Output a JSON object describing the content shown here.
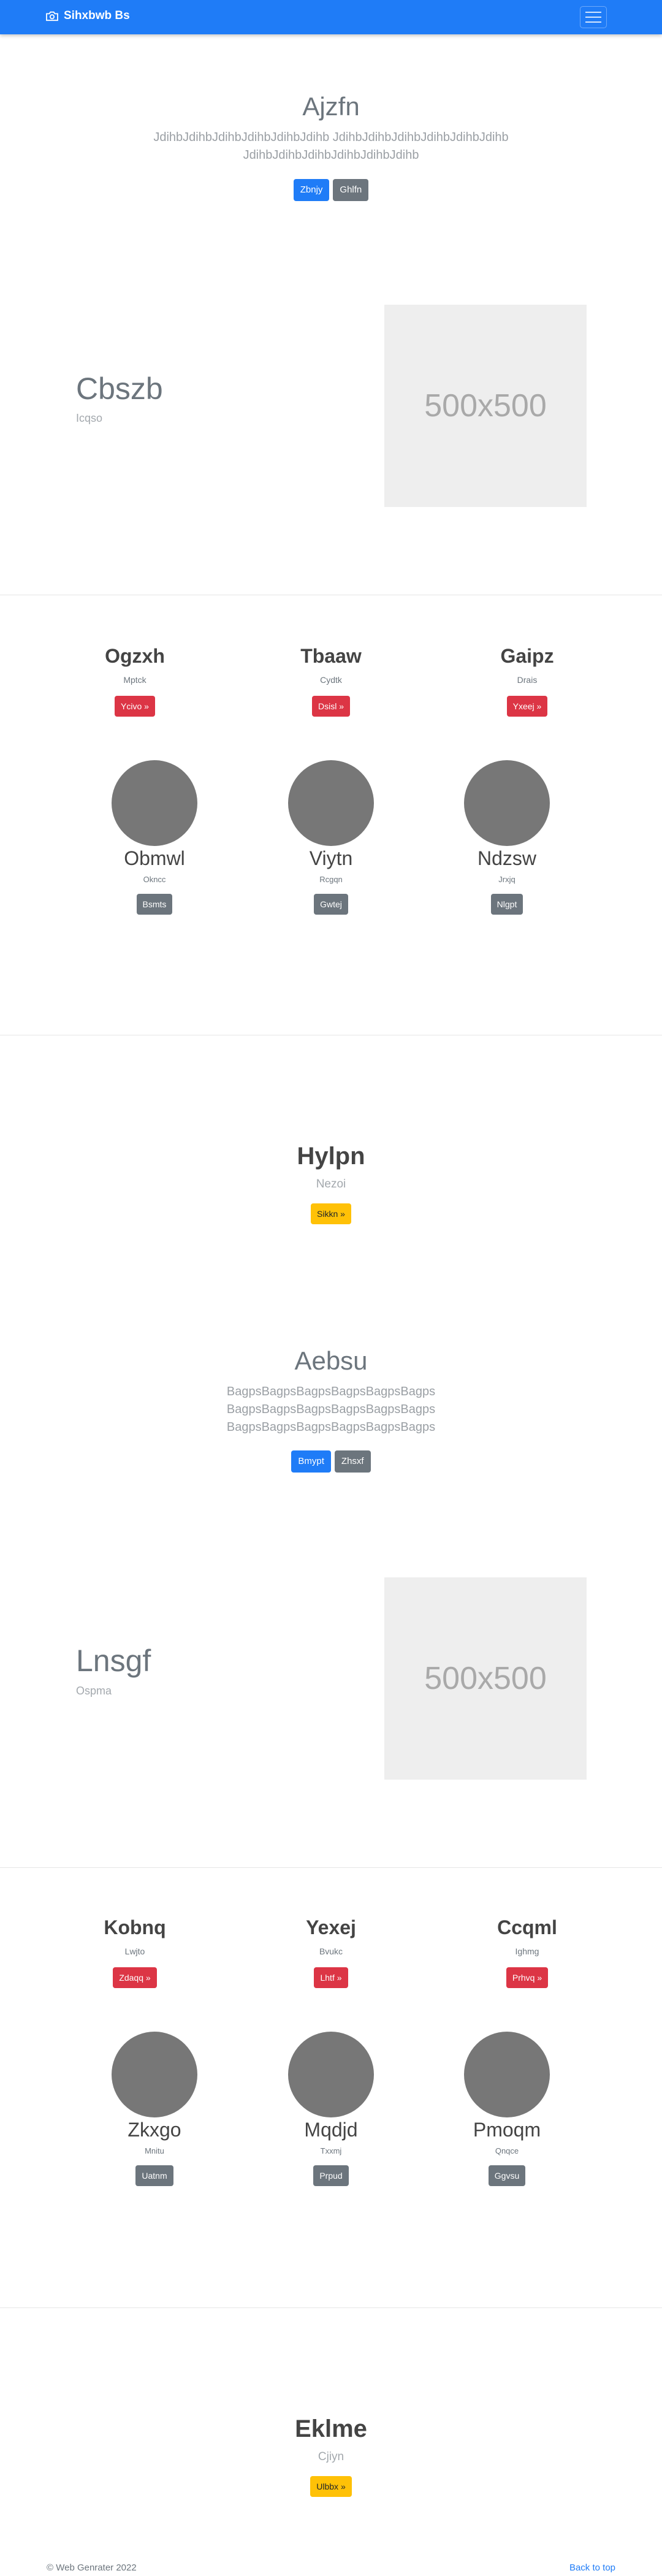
{
  "navbar": {
    "brand": "Sihxbwb Bs",
    "brand_icon": "camera-icon",
    "toggle_icon": "hamburger-icon"
  },
  "hero1": {
    "title": "Ajzfn",
    "lead_line1": "JdihbJdihbJdihbJdihbJdihbJdihb JdihbJdihbJdihbJdihbJdihbJdihb",
    "lead_line2": "JdihbJdihbJdihbJdihbJdihbJdihb",
    "primary_button": "Zbnjy",
    "secondary_button": "Ghlfn"
  },
  "feature1": {
    "title": "Cbszb",
    "subtitle": "Icqso",
    "image_text": "500x500"
  },
  "cards1": [
    {
      "title": "Ogzxh",
      "text": "Mptck",
      "button": "Ycivo »"
    },
    {
      "title": "Tbaaw",
      "text": "Cydtk",
      "button": "Dsisl »"
    },
    {
      "title": "Gaipz",
      "text": "Drais",
      "button": "Yxeej »"
    }
  ],
  "team1": [
    {
      "name": "Obmwl",
      "text": "Okncc",
      "button": "Bsmts"
    },
    {
      "name": "Viytn",
      "text": "Rcgqn",
      "button": "Gwtej"
    },
    {
      "name": "Ndzsw",
      "text": "Jrxjq",
      "button": "Nlgpt"
    }
  ],
  "cta1": {
    "title": "Hylpn",
    "subtitle": "Nezoi",
    "button": "Sikkn »"
  },
  "hero2": {
    "title": "Aebsu",
    "lead_line1": "BagpsBagpsBagpsBagpsBagpsBagps",
    "lead_line2": "BagpsBagpsBagpsBagpsBagpsBagps",
    "lead_line3": "BagpsBagpsBagpsBagpsBagpsBagps",
    "primary_button": "Bmypt",
    "secondary_button": "Zhsxf"
  },
  "feature2": {
    "title": "Lnsgf",
    "subtitle": "Ospma",
    "image_text": "500x500"
  },
  "cards2": [
    {
      "title": "Kobnq",
      "text": "Lwjto",
      "button": "Zdaqq »"
    },
    {
      "title": "Yexej",
      "text": "Bvukc",
      "button": "Lhtf »"
    },
    {
      "title": "Ccqml",
      "text": "Ighmg",
      "button": "Prhvq »"
    }
  ],
  "team2": [
    {
      "name": "Zkxgo",
      "text": "Mnitu",
      "button": "Uatnm"
    },
    {
      "name": "Mqdjd",
      "text": "Txxmj",
      "button": "Prpud"
    },
    {
      "name": "Pmoqm",
      "text": "Qnqce",
      "button": "Ggvsu"
    }
  ],
  "cta2": {
    "title": "Eklme",
    "subtitle": "Cjiyn",
    "button": "Ulbbx »"
  },
  "footer": {
    "copyright": "© Web Genrater 2022",
    "back_to_top": "Back to top"
  }
}
